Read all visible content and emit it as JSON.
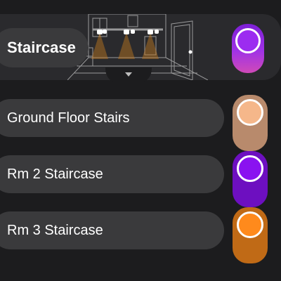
{
  "header": {
    "title": "Staircase",
    "toggle": {
      "on": true,
      "color": "#9c2cf0",
      "track_gradient": [
        "#7d1fd6",
        "#d04ab8"
      ]
    }
  },
  "rows": [
    {
      "label": "Ground Floor Stairs",
      "toggle_on": true,
      "color": "#f5b78a",
      "track": "#b88a6c"
    },
    {
      "label": "Rm 2 Staircase",
      "toggle_on": true,
      "color": "#8a12f0",
      "track": "#6d0fc0"
    },
    {
      "label": "Rm 3 Staircase",
      "toggle_on": true,
      "color": "#ff8a1c",
      "track": "#c06a16"
    }
  ],
  "icons": {
    "collapse": "chevron-down-icon"
  }
}
